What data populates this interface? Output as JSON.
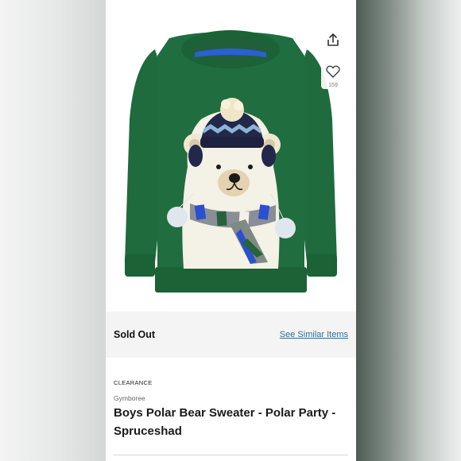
{
  "product": {
    "likes": "159",
    "status": "Sold Out",
    "similar_link": "See Similar Items",
    "badge": "CLEARANCE",
    "brand": "Gymboree",
    "title": "Boys Polar Bear Sweater - Polar Party - Spruceshad"
  },
  "icons": {
    "share": "share-icon",
    "like": "heart-icon"
  },
  "colors": {
    "sweater": "#1f6b3d",
    "link": "#2f6f95",
    "status_bar": "#f4f4f4"
  }
}
